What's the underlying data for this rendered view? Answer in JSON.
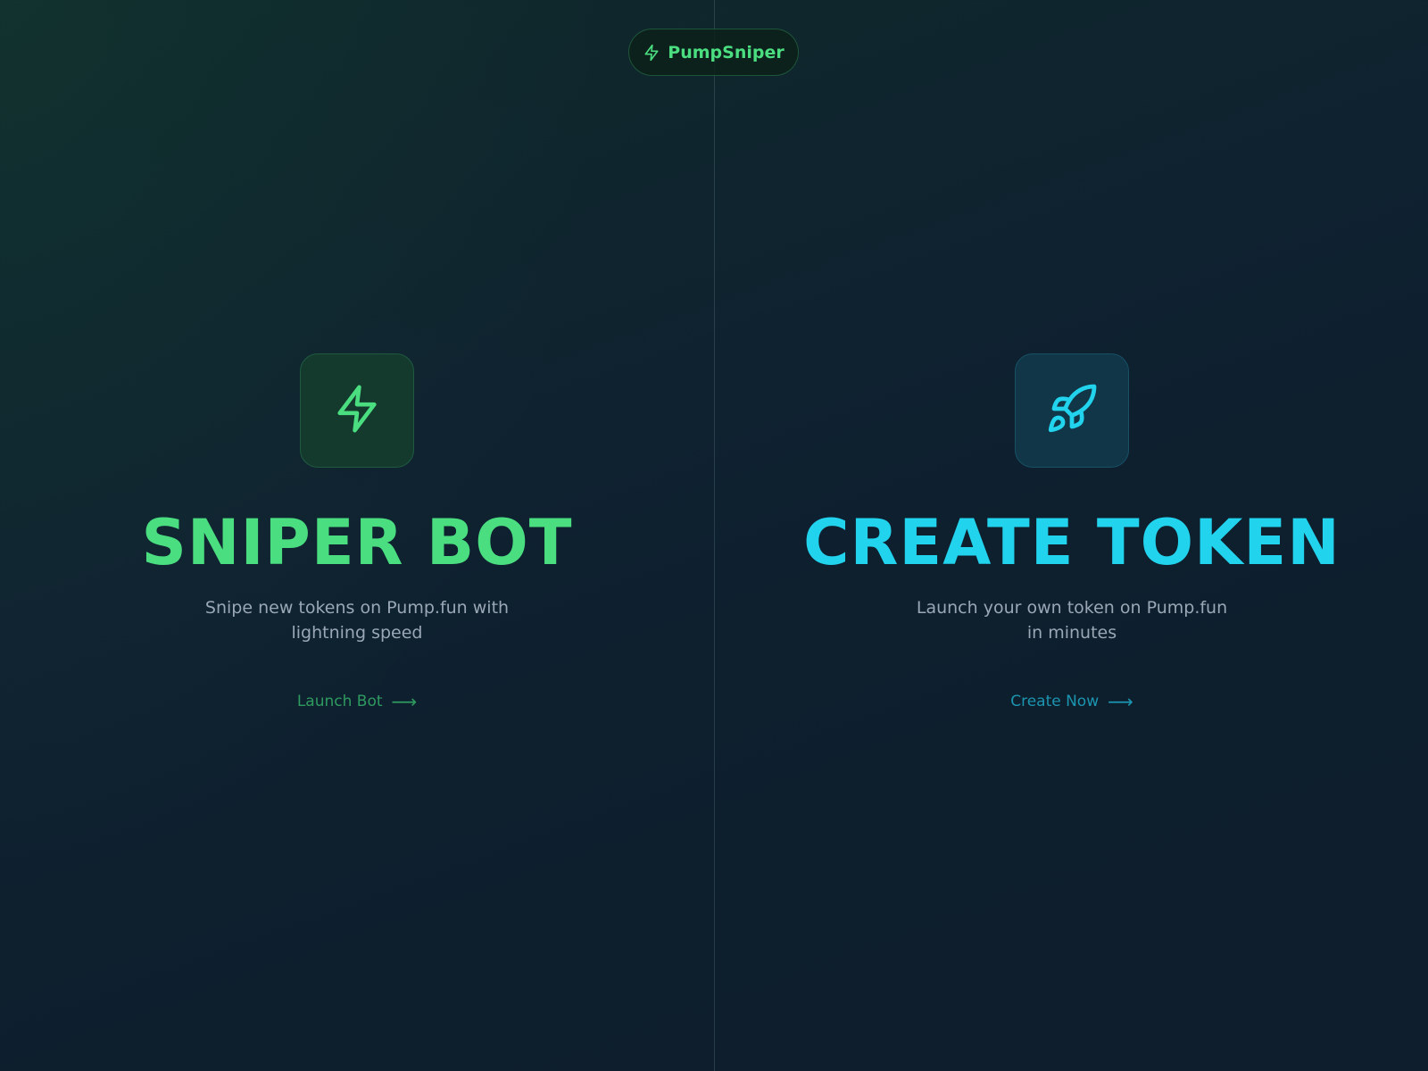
{
  "brand": {
    "name": "PumpSniper",
    "icon": "lightning-icon",
    "color": "#4ade80"
  },
  "panels": [
    {
      "id": "sniper-bot",
      "icon": "lightning-icon",
      "title": "SNIPER BOT",
      "description": "Snipe new tokens on Pump.fun with lightning speed",
      "cta_label": "Launch Bot",
      "cta_arrow": "⟶",
      "accent": "#4ade80"
    },
    {
      "id": "create-token",
      "icon": "rocket-icon",
      "title": "CREATE TOKEN",
      "description": "Launch your own token on Pump.fun in minutes",
      "cta_label": "Create Now",
      "cta_arrow": "⟶",
      "accent": "#22d3ee"
    }
  ]
}
